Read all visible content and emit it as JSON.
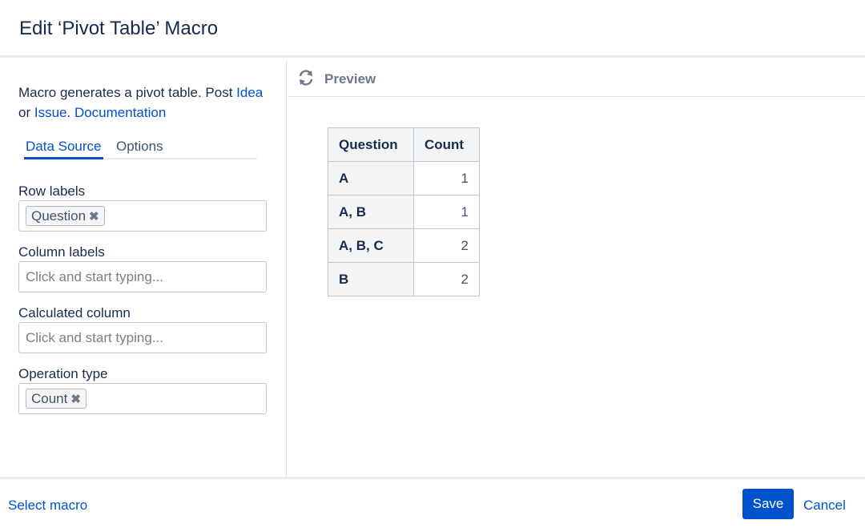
{
  "dialog": {
    "title": "Edit ‘Pivot Table’ Macro"
  },
  "description": {
    "text_1": "Macro generates a pivot table. Post ",
    "link_idea": "Idea",
    "text_2": " or ",
    "link_issue": "Issue",
    "text_3": ". ",
    "link_docs": "Documentation"
  },
  "tabs": [
    {
      "label": "Data Source",
      "active": true
    },
    {
      "label": "Options",
      "active": false
    }
  ],
  "fields": {
    "row_labels": {
      "label": "Row labels",
      "chip": "Question"
    },
    "column_labels": {
      "label": "Column labels",
      "placeholder": "Click and start typing..."
    },
    "calculated_column": {
      "label": "Calculated column",
      "placeholder": "Click and start typing..."
    },
    "operation_type": {
      "label": "Operation type",
      "chip": "Count"
    }
  },
  "preview": {
    "label": "Preview",
    "icon": "refresh-icon",
    "table": {
      "headers": [
        "Question",
        "Count"
      ],
      "rows": [
        {
          "question": "A",
          "count": "1"
        },
        {
          "question": "A, B",
          "count": "1"
        },
        {
          "question": "A, B, C",
          "count": "2"
        },
        {
          "question": "B",
          "count": "2"
        }
      ]
    }
  },
  "footer": {
    "select_macro": "Select macro",
    "save": "Save",
    "cancel": "Cancel"
  },
  "colors": {
    "accent": "#0052cc",
    "text": "#172b4d"
  }
}
